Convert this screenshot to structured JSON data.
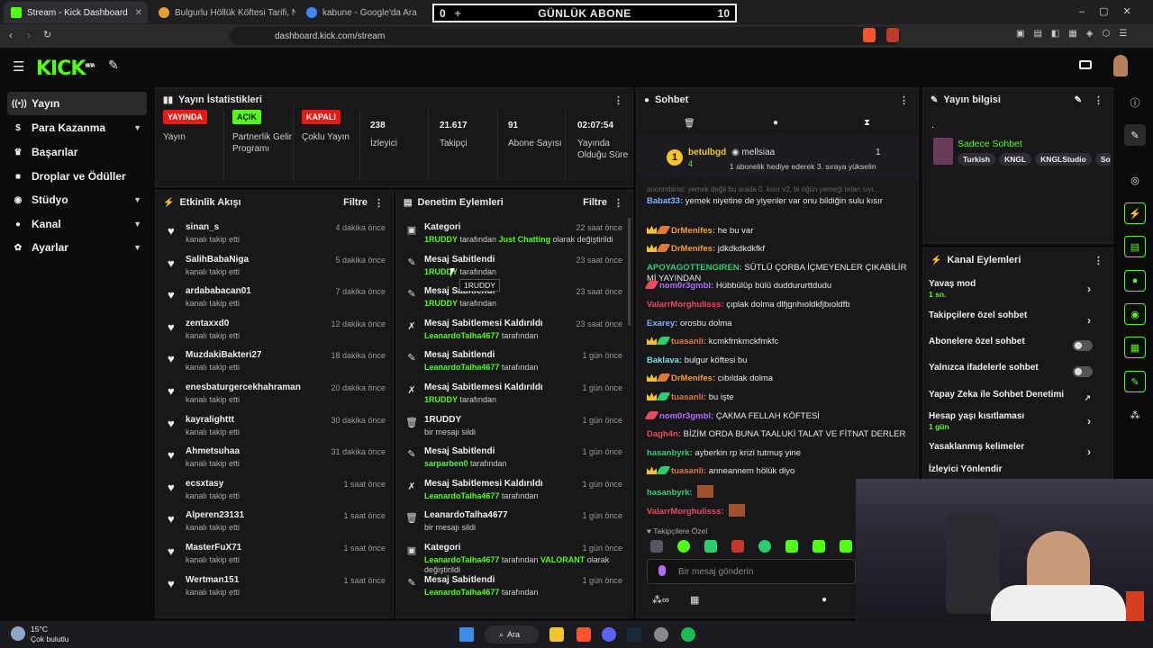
{
  "browser": {
    "tabs": [
      {
        "title": "Stream - Kick Dashboard",
        "color": "#53fc18"
      },
      {
        "title": "Bulgurlu Höllük Köftesi Tarifi, Nasıl Ya",
        "color": "#e0a030"
      },
      {
        "title": "kabune - Google'da Ara",
        "color": "#4285f4"
      }
    ],
    "url": "dashboard.kick.com/stream"
  },
  "overlay": {
    "left": "0",
    "plus": "+",
    "title": "GÜNLÜK ABONE",
    "right": "10"
  },
  "logo": "KICK",
  "logo_tag": "BETA",
  "sidebar": {
    "items": [
      {
        "label": "Yayın",
        "icon": "broadcast-icon"
      },
      {
        "label": "Para Kazanma",
        "icon": "dollar-icon"
      },
      {
        "label": "Başarılar",
        "icon": "trophy-icon"
      },
      {
        "label": "Droplar ve Ödüller",
        "icon": "gift-icon"
      },
      {
        "label": "Stüdyo",
        "icon": "studio-icon"
      },
      {
        "label": "Kanal",
        "icon": "user-icon"
      },
      {
        "label": "Ayarlar",
        "icon": "gear-icon"
      }
    ]
  },
  "stats": {
    "title": "Yayın İstatistikleri",
    "items": [
      {
        "badge": "YAYINDA",
        "badge_color": "#e91916",
        "label": "Yayın"
      },
      {
        "badge": "AÇIK",
        "badge_color": "#53fc18",
        "label": "Partnerlik Gelir Programı"
      },
      {
        "badge": "KAPALI",
        "badge_color": "#e91916",
        "label": "Çoklu Yayın"
      },
      {
        "value": "238",
        "label": "İzleyici"
      },
      {
        "value": "21.617",
        "label": "Takipçi"
      },
      {
        "value": "91",
        "label": "Abone Sayısı"
      },
      {
        "value": "02:07:54",
        "label": "Yayında Olduğu Süre"
      }
    ]
  },
  "events": {
    "title": "Etkinlik Akışı",
    "filter": "Filtre",
    "items": [
      {
        "name": "sinan_s",
        "sub": "kanalı takip etti",
        "time": "4 dakika önce"
      },
      {
        "name": "SalihBabaNiga",
        "sub": "kanalı takip etti",
        "time": "5 dakika önce"
      },
      {
        "name": "ardababacan01",
        "sub": "kanalı takip etti",
        "time": "7 dakika önce"
      },
      {
        "name": "zentaxxd0",
        "sub": "kanalı takip etti",
        "time": "12 dakika önce"
      },
      {
        "name": "MuzdakiBakteri27",
        "sub": "kanalı takip etti",
        "time": "18 dakika önce"
      },
      {
        "name": "enesbaturgercekhahraman",
        "sub": "kanalı takip etti",
        "time": "20 dakika önce"
      },
      {
        "name": "kayralighttt",
        "sub": "kanalı takip etti",
        "time": "30 dakika önce"
      },
      {
        "name": "Ahmetsuhaa",
        "sub": "kanalı takip etti",
        "time": "31 dakika önce"
      },
      {
        "name": "ecsxtasy",
        "sub": "kanalı takip etti",
        "time": "1 saat önce"
      },
      {
        "name": "Alperen23131",
        "sub": "kanalı takip etti",
        "time": "1 saat önce"
      },
      {
        "name": "MasterFuX71",
        "sub": "kanalı takip etti",
        "time": "1 saat önce"
      },
      {
        "name": "Wertman151",
        "sub": "kanalı takip etti",
        "time": "1 saat önce"
      }
    ]
  },
  "moderation": {
    "title": "Denetim Eylemleri",
    "filter": "Filtre",
    "items": [
      {
        "icon": "category-icon",
        "title": "Kategori",
        "time": "22 saat önce",
        "parts": [
          {
            "t": "1RUDDY",
            "g": true
          },
          {
            "t": " tarafından "
          },
          {
            "t": "Just Chatting",
            "g": true
          },
          {
            "t": " olarak değiştirildi"
          }
        ]
      },
      {
        "icon": "pin-icon",
        "title": "Mesaj Sabitlendi",
        "time": "23 saat önce",
        "parts": [
          {
            "t": "1RUDDY",
            "g": true
          },
          {
            "t": " tarafından"
          }
        ]
      },
      {
        "icon": "pin-icon",
        "title": "Mesaj Sabitlendi",
        "time": "23 saat önce",
        "parts": [
          {
            "t": "1RUDDY",
            "g": true
          },
          {
            "t": " tarafından"
          }
        ]
      },
      {
        "icon": "unpin-icon",
        "title": "Mesaj Sabitlemesi Kaldırıldı",
        "time": "23 saat önce",
        "parts": [
          {
            "t": "LeanardoTalha4677",
            "g": true
          },
          {
            "t": " tarafından"
          }
        ]
      },
      {
        "icon": "pin-icon",
        "title": "Mesaj Sabitlendi",
        "time": "1 gün önce",
        "parts": [
          {
            "t": "LeanardoTalha4677",
            "g": true
          },
          {
            "t": " tarafından"
          }
        ]
      },
      {
        "icon": "unpin-icon",
        "title": "Mesaj Sabitlemesi Kaldırıldı",
        "time": "1 gün önce",
        "parts": [
          {
            "t": "1RUDDY",
            "g": true
          },
          {
            "t": " tarafından"
          }
        ]
      },
      {
        "icon": "trash-icon",
        "title": "1RUDDY",
        "time": "1 gün önce",
        "parts": [
          {
            "t": "bir mesajı sildi"
          }
        ]
      },
      {
        "icon": "pin-icon",
        "title": "Mesaj Sabitlendi",
        "time": "1 gün önce",
        "parts": [
          {
            "t": "sarparben0",
            "g": true
          },
          {
            "t": " tarafından"
          }
        ]
      },
      {
        "icon": "unpin-icon",
        "title": "Mesaj Sabitlemesi Kaldırıldı",
        "time": "1 gün önce",
        "parts": [
          {
            "t": "LeanardoTalha4677",
            "g": true
          },
          {
            "t": " tarafından"
          }
        ]
      },
      {
        "icon": "trash-icon",
        "title": "LeanardoTalha4677",
        "time": "1 gün önce",
        "parts": [
          {
            "t": "bir mesajı sildi"
          }
        ]
      },
      {
        "icon": "category-icon",
        "title": "Kategori",
        "time": "1 gün önce",
        "parts": [
          {
            "t": "LeanardoTalha4677",
            "g": true
          },
          {
            "t": " tarafından "
          },
          {
            "t": "VALORANT",
            "g": true
          },
          {
            "t": " olarak değiştirildi"
          }
        ]
      },
      {
        "icon": "pin-icon",
        "title": "Mesaj Sabitlendi",
        "time": "1 gün önce",
        "parts": [
          {
            "t": "LeanardoTalha4677",
            "g": true
          },
          {
            "t": " tarafından"
          }
        ]
      }
    ],
    "tooltip": "1RUDDY"
  },
  "chat": {
    "title": "Sohbet",
    "pinned": {
      "badge": "1",
      "user1": "betulbgd",
      "user1_count": "4",
      "user2": "mellsiaa",
      "user2_count": "1",
      "text": "1 abonelik hediye ederek 3. sıraya yükselin"
    },
    "faded": "anonmbirisi: yemek değil bu arada 0, kısır v2, bi öğün yemeği telan sıyı...",
    "messages": [
      {
        "badges": [],
        "user": "Babat33",
        "color": "#7fb2ff",
        "text": "yemek niyetine de yiyenler var onu bildiğin sulu kısır"
      },
      {
        "badges": [
          "crown",
          "sword"
        ],
        "user": "DrMenifes",
        "color": "#f0a030",
        "text": "he bu var"
      },
      {
        "badges": [
          "crown",
          "sword"
        ],
        "user": "DrMenifes",
        "color": "#f0a030",
        "text": "jdkdkdkdkfkf"
      },
      {
        "badges": [],
        "user": "APOYAGOTTENGIREN",
        "color": "#2ecc71",
        "text": "SÜTLÜ ÇORBA İÇMEYENLER ÇIKABİLİR Mİ YAYINDAN"
      },
      {
        "badges": [
          "swordr"
        ],
        "user": "nom0r3gmbl",
        "color": "#b36bff",
        "text": "Hübbülüp bülü duddururttdudu"
      },
      {
        "badges": [],
        "user": "ValarrMorghulisss",
        "color": "#e84a5f",
        "text": "çıplak dolma dlfjgnhıoldkfjbıoldfb"
      },
      {
        "badges": [],
        "user": "Exarey",
        "color": "#7fb2ff",
        "text": "orosbu dolma"
      },
      {
        "badges": [
          "crown",
          "swordg"
        ],
        "user": "tuasanli",
        "color": "#e07a3a",
        "text": "kcmkfmkmckfmkfc"
      },
      {
        "badges": [],
        "user": "Baklava",
        "color": "#7fe0e0",
        "text": "bulgur köftesi bu"
      },
      {
        "badges": [
          "crown",
          "sword"
        ],
        "user": "DrMenifes",
        "color": "#f0a030",
        "text": "cıbıldak dolma"
      },
      {
        "badges": [
          "crown",
          "swordg"
        ],
        "user": "tuasanli",
        "color": "#e07a3a",
        "text": "bu işte"
      },
      {
        "badges": [
          "swordr"
        ],
        "user": "nom0r3gmbl",
        "color": "#b36bff",
        "text": "ÇAKMA FELLAH KÖFTESİ"
      },
      {
        "badges": [],
        "user": "Dagh4n",
        "color": "#e84a5f",
        "text": "BİZİM ORDA BUNA TAALUKİ TALAT VE FİTNAT DERLER"
      },
      {
        "badges": [],
        "user": "hasanbyrk",
        "color": "#2ecc71",
        "text": "ayberkin rp krizi tutmuş yine"
      },
      {
        "badges": [
          "crown",
          "swordg"
        ],
        "user": "tuasanli",
        "color": "#e07a3a",
        "text": "anneannem hölük diyo"
      },
      {
        "badges": [],
        "user": "hasanbyrk",
        "color": "#2ecc71",
        "text": ""
      },
      {
        "badges": [],
        "user": "ValarrMorghulisss",
        "color": "#e84a5f",
        "text": ""
      }
    ],
    "followers_only": "Takipçilere Özel",
    "input_placeholder": "Bir mesaj gönderin"
  },
  "stream_info": {
    "title": "Yayın bilgisi",
    "text": ".",
    "stream_title": "Sadece Sohbet",
    "tags": [
      "Turkish",
      "KNGL",
      "KNGLStudio",
      "So"
    ]
  },
  "channel_actions": {
    "title": "Kanal Eylemleri",
    "items": [
      {
        "label": "Yavaş mod",
        "sub": "1 sn.",
        "type": "chevron"
      },
      {
        "label": "Takipçilere özel sohbet",
        "sub": "",
        "type": "chevron"
      },
      {
        "label": "Abonelere özel sohbet",
        "sub": "",
        "type": "toggle"
      },
      {
        "label": "Yalnızca ifadelerle sohbet",
        "sub": "",
        "type": "toggle"
      },
      {
        "label": "Yapay Zeka ile Sohbet Denetimi",
        "sub": "",
        "type": "external"
      },
      {
        "label": "Hesap yaşı kısıtlaması",
        "sub": "1 gün",
        "type": "chevron"
      },
      {
        "label": "Yasaklanmış kelimeler",
        "sub": "",
        "type": "chevron"
      },
      {
        "label": "İzleyici Yönlendir",
        "sub": "",
        "type": "none"
      }
    ]
  },
  "taskbar": {
    "temp": "15°C",
    "weather": "Çok bulutlu",
    "search": "Ara"
  }
}
